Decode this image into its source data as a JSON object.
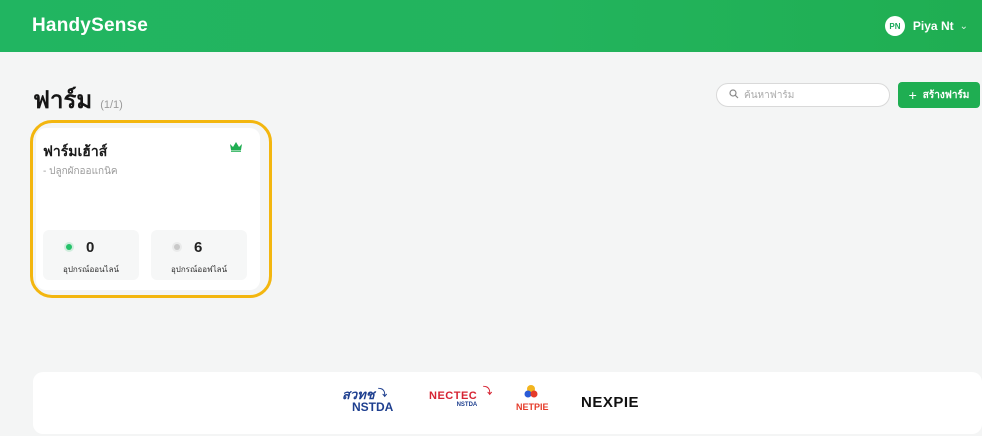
{
  "header": {
    "brand": "HandySense",
    "user": {
      "initials": "PN",
      "name": "Piya Nt"
    }
  },
  "page": {
    "title": "ฟาร์ม",
    "count": "(1/1)",
    "search_placeholder": "ค้นหาฟาร์ม",
    "create_label": "สร้างฟาร์ม"
  },
  "farms": [
    {
      "name": "ฟาร์มเฮ้าส์",
      "subtitle": "- ปลูกผักออแกนิค",
      "online": {
        "count": "0",
        "label": "อุปกรณ์ออนไลน์"
      },
      "offline": {
        "count": "6",
        "label": "อุปกรณ์ออฟไลน์"
      },
      "icon": "crown-icon"
    }
  ],
  "footer": {
    "logos": {
      "nstda_th": "สวทช",
      "nstda_en": "NSTDA",
      "nectec": "NECTEC",
      "nectec_sub": "NSTDA",
      "netpie": "NETPIE",
      "nexpie": "NEXPIE"
    }
  },
  "colors": {
    "primary": "#1fae52",
    "highlight": "#f3b60f",
    "online_dot": "#25c26a",
    "offline_dot": "#c9c9c9"
  }
}
